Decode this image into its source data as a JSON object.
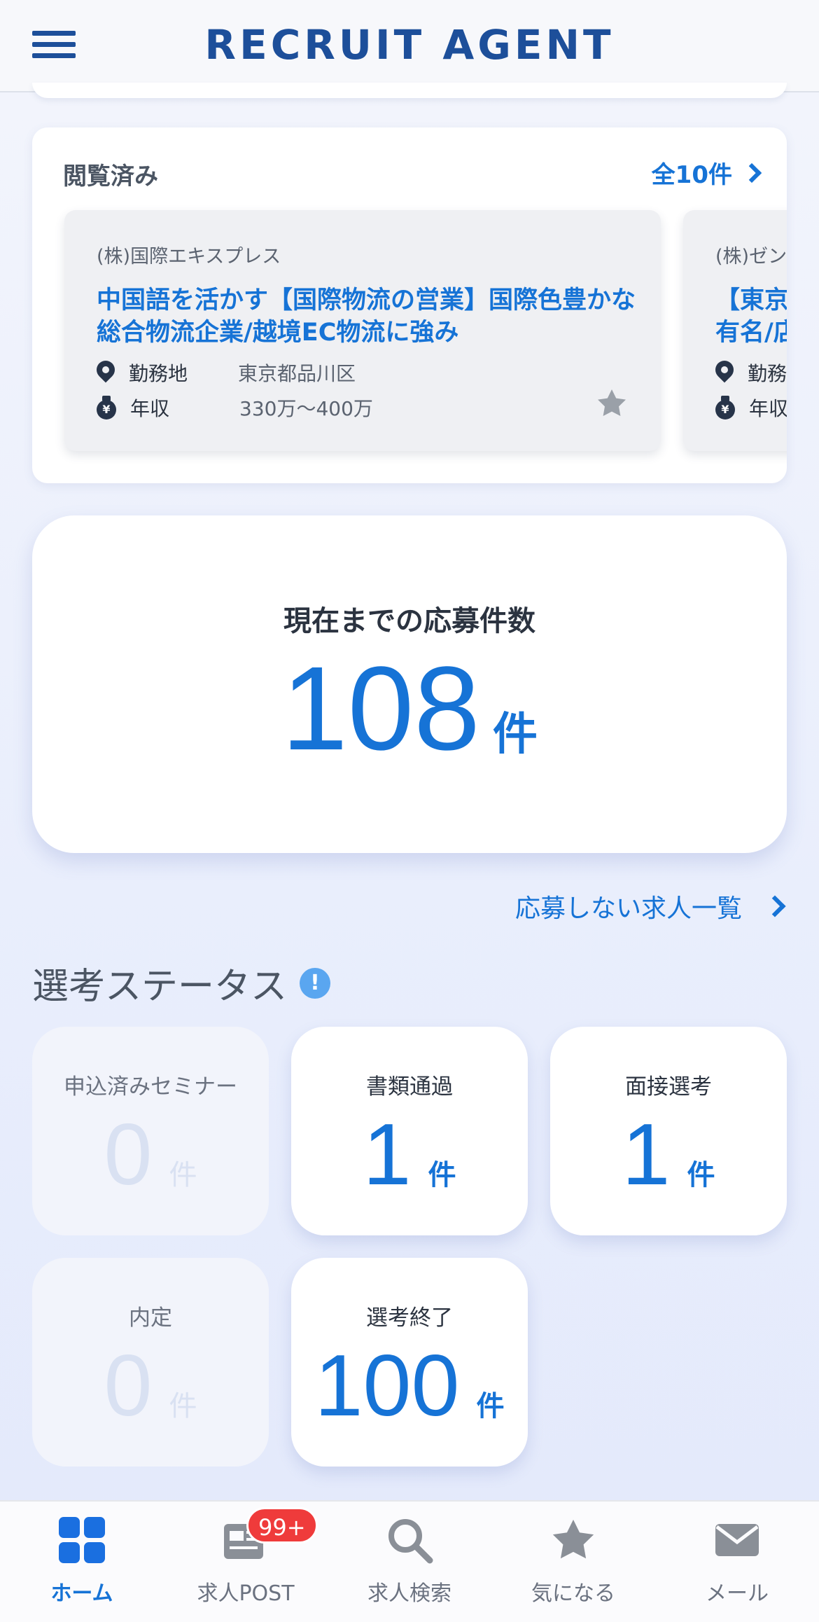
{
  "header": {
    "logo": "RECRUIT AGENT"
  },
  "viewed": {
    "title": "閲覧済み",
    "all_label": "全10件",
    "jobs": [
      {
        "company": "(株)国際エキスプレス",
        "title": "中国語を活かす【国際物流の営業】国際色豊かな総合物流企業/越境EC物流に強み",
        "location_label": "勤務地",
        "location": "東京都品川区",
        "salary_label": "年収",
        "salary": "330万～400万"
      },
      {
        "company": "(株)ゼンショ",
        "title_line1": "【東京】ユ",
        "title_line2": "有名/店舗",
        "location_label": "勤務地",
        "salary_label": "年収"
      }
    ]
  },
  "applications": {
    "label": "現在までの応募件数",
    "count": "108",
    "unit": "件"
  },
  "not_applied_link": "応募しない求人一覧",
  "status": {
    "title": "選考ステータス",
    "tiles": [
      {
        "label": "申込済みセミナー",
        "value": "0",
        "unit": "件"
      },
      {
        "label": "書類通過",
        "value": "1",
        "unit": "件"
      },
      {
        "label": "面接選考",
        "value": "1",
        "unit": "件"
      },
      {
        "label": "内定",
        "value": "0",
        "unit": "件"
      },
      {
        "label": "選考終了",
        "value": "100",
        "unit": "件"
      }
    ]
  },
  "bottom_nav": [
    {
      "label": "ホーム",
      "icon": "grid-icon",
      "active": true
    },
    {
      "label": "求人POST",
      "icon": "newspaper-icon",
      "badge": "99+"
    },
    {
      "label": "求人検索",
      "icon": "search-icon"
    },
    {
      "label": "気になる",
      "icon": "star-icon"
    },
    {
      "label": "メール",
      "icon": "mail-icon"
    }
  ],
  "colors": {
    "brand": "#1d4f9a",
    "accent": "#1673d6",
    "badge": "#ef3b3b"
  }
}
